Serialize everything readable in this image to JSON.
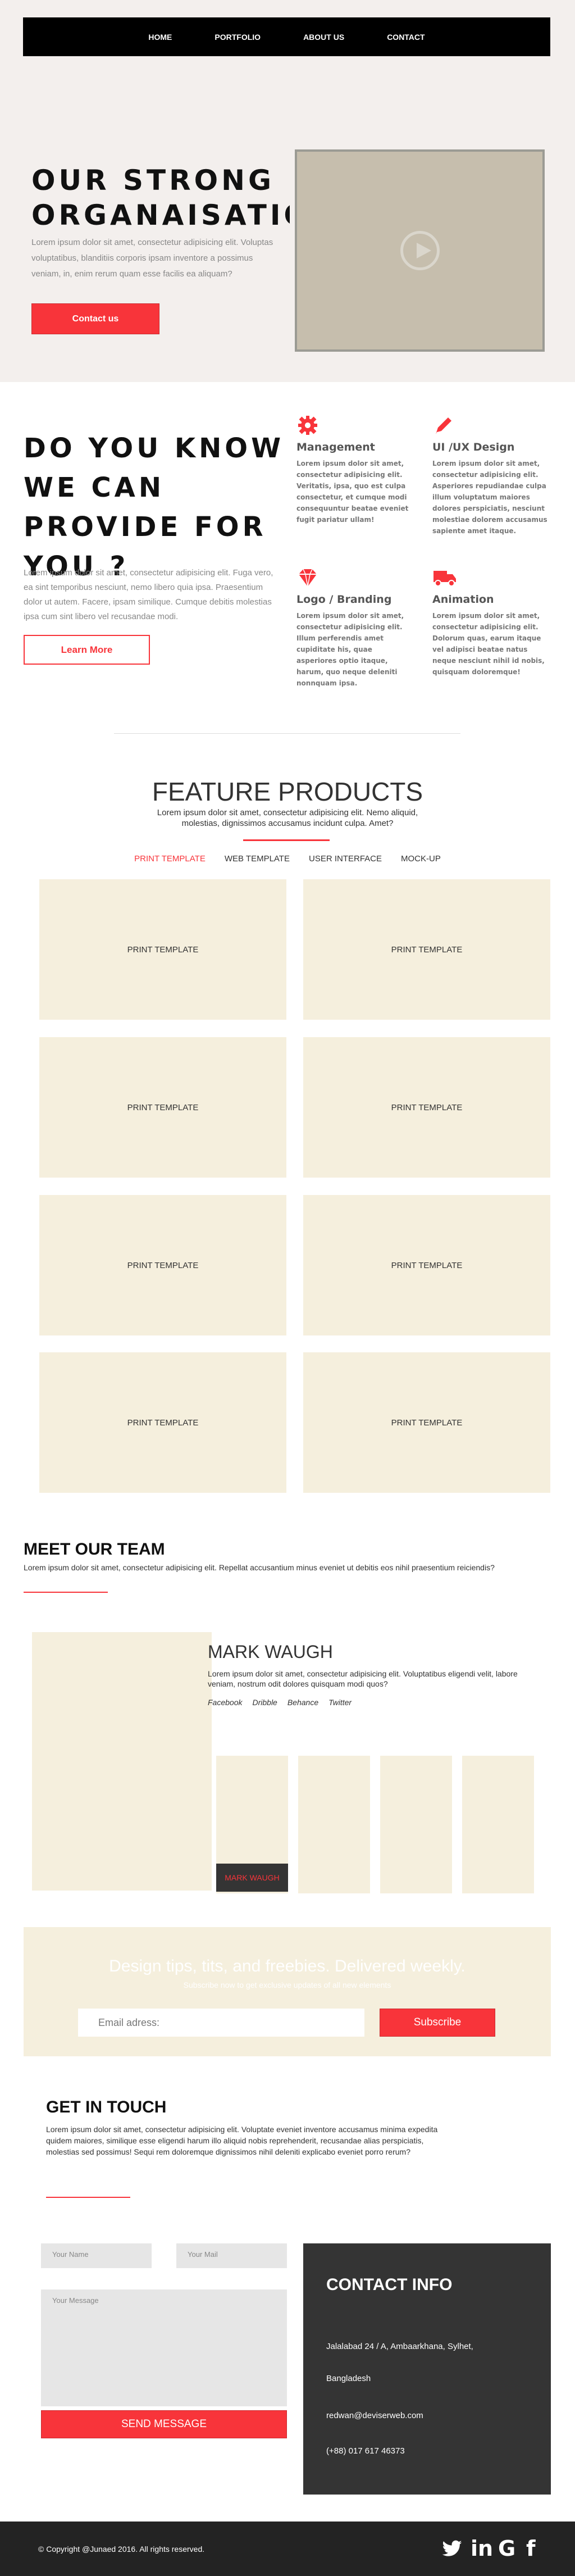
{
  "nav": {
    "items": [
      "HOME",
      "PORTFOLIO",
      "ABOUT US",
      "CONTACT"
    ]
  },
  "hero": {
    "title": "OUR STRONG\nORGANAISATIO",
    "text": "Lorem ipsum dolor sit amet, consectetur adipisicing elit. Voluptas voluptatibus, blanditiis corporis ipsam inventore a possimus veniam, in, enim rerum quam esse facilis ea aliquam?",
    "button": "Contact us",
    "video_icon": "play-circle-icon"
  },
  "services": {
    "title": "DO YOU KNOW\nWE CAN\nPROVIDE FOR\nYOU ?",
    "text": "Lorem ipsum dolor sit amet, consectetur adipisicing elit. Fuga vero, ea sint temporibus nesciunt, nemo libero quia ipsa. Praesentium dolor ut autem. Facere, ipsam similique. Cumque debitis molestias ipsa cum sint libero vel recusandae modi.",
    "button": "Learn More",
    "items": [
      {
        "icon": "gear-icon",
        "title": "Management",
        "text": "Lorem ipsum dolor sit amet, consectetur adipisicing elit. Veritatis, ipsa, quo est culpa consectetur, et cumque modi consequuntur beatae eveniet fugit pariatur ullam!"
      },
      {
        "icon": "pencil-icon",
        "title": "UI /UX Design",
        "text": "Lorem ipsum dolor sit amet, consectetur adipisicing elit. Asperiores repudiandae culpa illum voluptatum maiores dolores perspiciatis, nesciunt molestiae dolorem accusamus sapiente amet itaque."
      },
      {
        "icon": "diamond-icon",
        "title": "Logo / Branding",
        "text": "Lorem ipsum dolor sit amet, consectetur adipisicing elit. Illum perferendis amet cupiditate his, quae asperiores optio itaque, harum, quo neque deleniti nonnquam ipsa."
      },
      {
        "icon": "truck-icon",
        "title": "Animation",
        "text": "Lorem ipsum dolor sit amet, consectetur adipisicing elit. Dolorum quas, earum itaque vel adipisci beatae natus neque nesciunt nihil id nobis, quisquam doloremque!"
      }
    ]
  },
  "features": {
    "title": "FEATURE PRODUCTS",
    "subtitle": "Lorem ipsum dolor sit amet, consectetur adipisicing elit. Nemo aliquid, molestias, dignissimos accusamus incidunt culpa. Amet?",
    "tabs": [
      "PRINT TEMPLATE",
      "WEB TEMPLATE",
      "USER INTERFACE",
      "MOCK-UP"
    ],
    "active_tab": "PRINT TEMPLATE",
    "cards": [
      "PRINT TEMPLATE",
      "PRINT TEMPLATE",
      "PRINT TEMPLATE",
      "PRINT TEMPLATE",
      "PRINT TEMPLATE",
      "PRINT TEMPLATE",
      "PRINT TEMPLATE",
      "PRINT TEMPLATE"
    ]
  },
  "team": {
    "title": "MEET OUR TEAM",
    "subtitle": "Lorem ipsum dolor sit amet, consectetur adipisicing elit. Repellat accusantium minus eveniet ut debitis eos nihil praesentium reiciendis?",
    "member_name": "MARK WAUGH",
    "member_text": "Lorem ipsum dolor sit amet, consectetur adipisicing elit. Voluptatibus eligendi velit, labore veniam, nostrum odit dolores quisquam modi quos?",
    "socials": [
      "Facebook",
      "Dribble",
      "Behance",
      "Twitter"
    ],
    "thumb_label": "MARK WAUGH"
  },
  "newsletter": {
    "title": "Design tips, tits, and freebies. Delivered weekly.",
    "subtitle": "Subscribe now to get exclusive updates of all new elements",
    "email_placeholder": "Email adress:",
    "button": "Subscribe"
  },
  "contact": {
    "title": "GET IN TOUCH",
    "text": "Lorem ipsum dolor sit amet, consectetur adipisicing elit. Voluptate eveniet inventore accusamus minima expedita quidem maiores, similique esse eligendi harum illo aliquid nobis reprehenderit, recusandae alias perspiciatis, molestias sed possimus! Sequi rem doloremque dignissimos nihil deleniti explicabo eveniet porro rerum?",
    "name_placeholder": "Your Name",
    "mail_placeholder": "Your Mail",
    "message_placeholder": "Your Message",
    "send_button": "SEND MESSAGE",
    "info_title": "CONTACT INFO",
    "address_1": "Jalalabad 24 / A, Ambaarkhana, Sylhet,",
    "address_2": "Bangladesh",
    "email": "redwan@deviserweb.com",
    "phone": "(+88) 017 617 46373"
  },
  "footer": {
    "copyright": "© Copyright @Junaed 2016. All rights reserved.",
    "icons": [
      "twitter-icon",
      "linkedin-icon",
      "google-icon",
      "facebook-icon"
    ]
  },
  "colors": {
    "accent": "#f8343a",
    "beige": "#f5efdd",
    "dark": "#343434",
    "hero_bg": "#f3efed"
  }
}
